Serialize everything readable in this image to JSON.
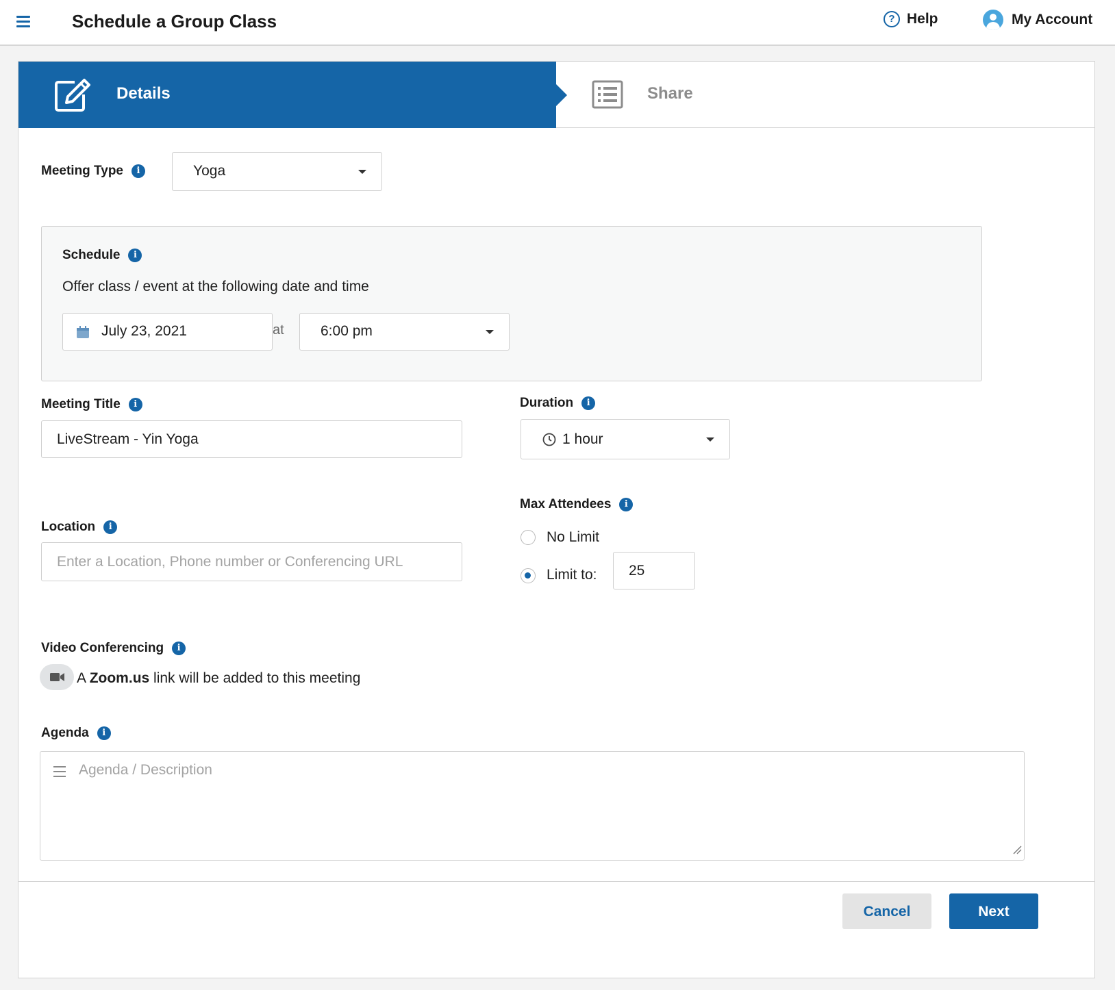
{
  "header": {
    "title": "Schedule a Group Class",
    "help_label": "Help",
    "account_label": "My Account"
  },
  "steps": {
    "details_label": "Details",
    "share_label": "Share"
  },
  "meeting_type": {
    "label": "Meeting Type",
    "value": "Yoga"
  },
  "schedule": {
    "label": "Schedule",
    "description": "Offer class / event at the following date and time",
    "date": "July 23, 2021",
    "at_label": "at",
    "time": "6:00 pm"
  },
  "meeting_title": {
    "label": "Meeting Title",
    "value": "LiveStream - Yin Yoga"
  },
  "duration": {
    "label": "Duration",
    "value": "1 hour"
  },
  "location": {
    "label": "Location",
    "value": "",
    "placeholder": "Enter a Location, Phone number or Conferencing URL"
  },
  "max_attendees": {
    "label": "Max Attendees",
    "no_limit_label": "No Limit",
    "limit_to_label": "Limit to:",
    "limit_value": "25",
    "selected": "limit"
  },
  "video_conferencing": {
    "label": "Video Conferencing",
    "prefix": "A",
    "provider": "Zoom.us",
    "suffix": "link will be added to this meeting"
  },
  "agenda": {
    "label": "Agenda",
    "placeholder": "Agenda / Description"
  },
  "footer": {
    "cancel_label": "Cancel",
    "next_label": "Next"
  },
  "colors": {
    "accent": "#1565a7",
    "page_background": "#f3f3f3",
    "inactive_step_text": "#8c8c8c"
  },
  "icons": {
    "menu": "hamburger-icon",
    "help": "question-circle-icon",
    "account": "user-avatar-icon",
    "details_step": "edit-pencil-icon",
    "share_step": "list-icon",
    "info": "info-icon",
    "calendar": "calendar-icon",
    "clock": "clock-icon",
    "video": "video-camera-icon"
  }
}
